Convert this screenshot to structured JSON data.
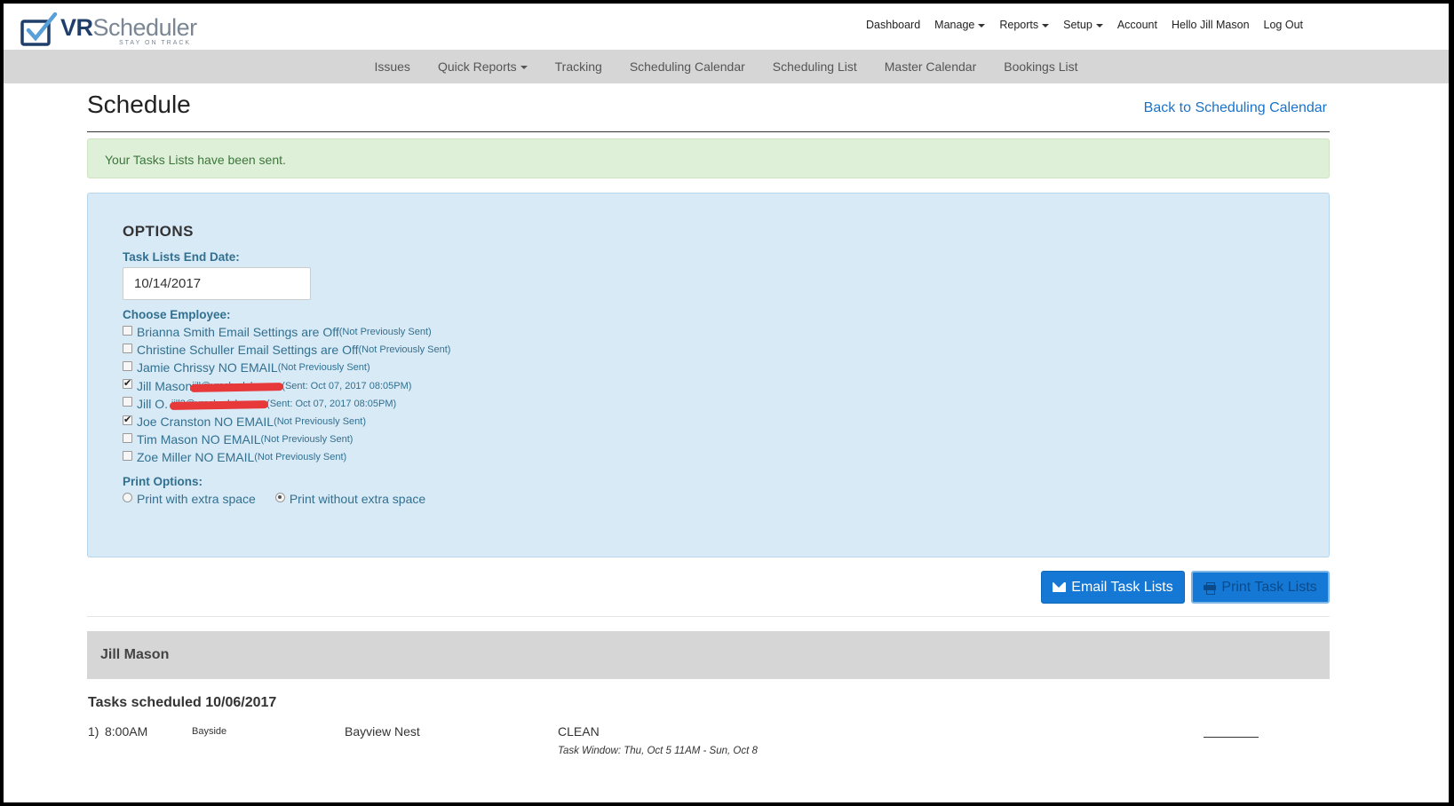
{
  "app": {
    "logo_text_bold": "VR",
    "logo_text_rest": "Scheduler",
    "logo_tagline": "STAY ON TRACK"
  },
  "topnav": {
    "dashboard": "Dashboard",
    "manage": "Manage",
    "reports": "Reports",
    "setup": "Setup",
    "account": "Account",
    "greeting": "Hello Jill Mason",
    "logout": "Log Out"
  },
  "subnav": {
    "issues": "Issues",
    "quick_reports": "Quick Reports",
    "tracking": "Tracking",
    "scheduling_calendar": "Scheduling Calendar",
    "scheduling_list": "Scheduling List",
    "master_calendar": "Master Calendar",
    "bookings_list": "Bookings List"
  },
  "page": {
    "title": "Schedule",
    "back_link": "Back to Scheduling Calendar",
    "alert": "Your Tasks Lists have been sent."
  },
  "options": {
    "heading": "OPTIONS",
    "end_date_label": "Task Lists End Date:",
    "end_date_value": "10/14/2017",
    "choose_employee_label": "Choose Employee:",
    "employees": [
      {
        "name": "Brianna Smith Email Settings are Off",
        "email": "",
        "status": "(Not Previously Sent)",
        "checked": false
      },
      {
        "name": "Christine Schuller Email Settings are Off",
        "email": "",
        "status": "(Not Previously Sent)",
        "checked": false
      },
      {
        "name": "Jamie Chrissy NO EMAIL",
        "email": "",
        "status": "(Not Previously Sent)",
        "checked": false
      },
      {
        "name": "Jill Mason",
        "email": "jill@vrscheduler.com",
        "status": "(Sent: Oct 07, 2017 08:05PM)",
        "checked": true
      },
      {
        "name": "Jill O.",
        "email": "jill2@vrscheduler.com",
        "status": "(Sent: Oct 07, 2017 08:05PM)",
        "checked": false
      },
      {
        "name": "Joe Cranston NO EMAIL",
        "email": "",
        "status": "(Not Previously Sent)",
        "checked": true
      },
      {
        "name": "Tim Mason NO EMAIL",
        "email": "",
        "status": "(Not Previously Sent)",
        "checked": false
      },
      {
        "name": "Zoe Miller NO EMAIL",
        "email": "",
        "status": "(Not Previously Sent)",
        "checked": false
      }
    ],
    "print_options_label": "Print Options:",
    "print_with_space": "Print with extra space",
    "print_without_space": "Print without extra space",
    "print_selected": "without"
  },
  "buttons": {
    "email": "Email Task Lists",
    "print": "Print Task Lists"
  },
  "employee_section": {
    "name": "Jill Mason",
    "tasks_heading": "Tasks scheduled 10/06/2017",
    "tasks": [
      {
        "number": "1)",
        "time": "8:00AM",
        "region": "Bayside",
        "property": "Bayview Nest",
        "task_type": "CLEAN",
        "task_window": "Task Window: Thu, Oct 5 11AM - Sun, Oct 8"
      }
    ]
  },
  "colors": {
    "brand_blue": "#1578d4",
    "alert_bg": "#dff0d8",
    "options_bg": "#d9eaf7",
    "label_blue": "#31708f",
    "redaction": "#e8393a"
  }
}
